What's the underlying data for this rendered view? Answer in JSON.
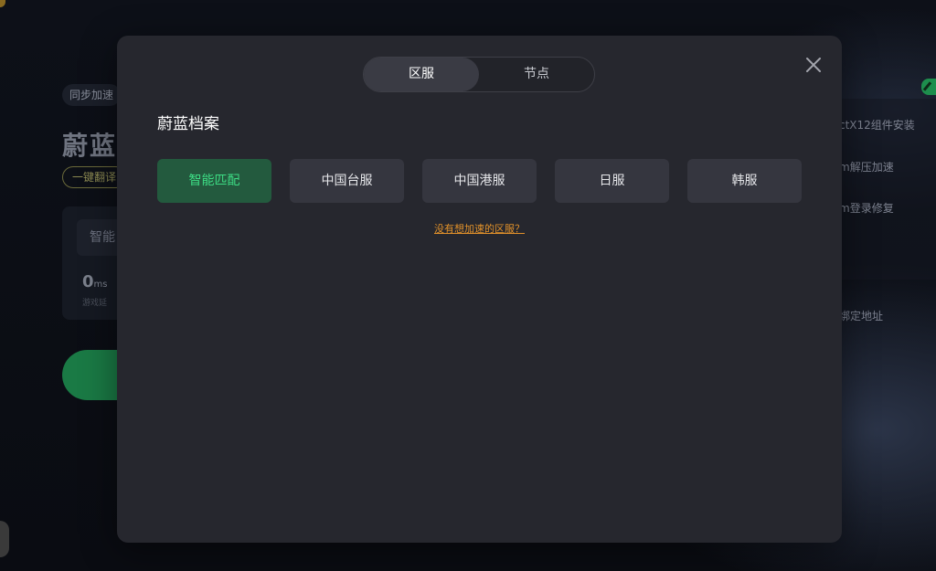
{
  "background": {
    "sync_tag": "同步加速",
    "game_title": "蔚蓝",
    "translate_tag": "一键翻译",
    "smart_short": "智能",
    "latency_value": "0",
    "latency_unit": "ms",
    "latency_caption": "游戏延",
    "right_items": [
      "ctX12组件安装",
      "m解压加速",
      "m登录修复",
      "绑定地址"
    ]
  },
  "modal": {
    "tabs": [
      {
        "label": "区服",
        "active": true
      },
      {
        "label": "节点",
        "active": false
      }
    ],
    "title": "蔚蓝档案",
    "regions": [
      {
        "label": "智能匹配",
        "active": true
      },
      {
        "label": "中国台服",
        "active": false
      },
      {
        "label": "中国港服",
        "active": false
      },
      {
        "label": "日服",
        "active": false
      },
      {
        "label": "韩服",
        "active": false
      }
    ],
    "missing_link": "没有想加速的区服？"
  },
  "colors": {
    "accent_green": "#3ddc84",
    "active_region_bg": "#235a3e",
    "link_orange": "#e0902a",
    "modal_bg": "#26272e"
  },
  "icons": {
    "close": "close-icon",
    "edit": "pencil-icon"
  }
}
